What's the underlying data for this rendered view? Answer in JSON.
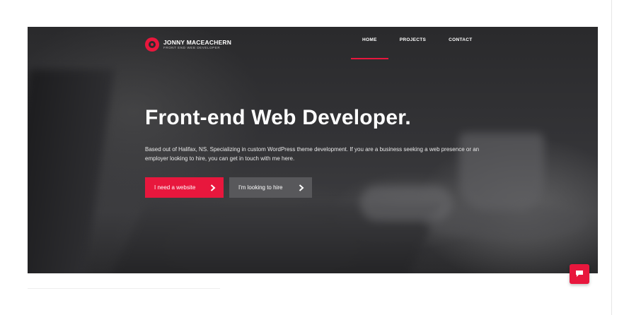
{
  "brand": {
    "name": "JONNY MACEACHERN",
    "tagline": "FRONT END WEB DEVELOPER"
  },
  "nav": {
    "items": [
      {
        "label": "HOME",
        "active": true
      },
      {
        "label": "PROJECTS",
        "active": false
      },
      {
        "label": "CONTACT",
        "active": false
      }
    ]
  },
  "hero": {
    "headline": "Front-end Web Developer.",
    "lead": "Based out of Halifax, NS. Specializing in custom WordPress theme development. If you are a business seeking a web presence or an employer looking to hire, you can get in touch with me here.",
    "primary_button": "I need a website",
    "secondary_button": "I'm looking to hire"
  },
  "icons": {
    "chevron": "chevron-right-icon",
    "chat": "chat-icon",
    "logo": "logo-icon"
  },
  "colors": {
    "accent": "#e8173d",
    "secondary_button": "#58585b",
    "hero_bg": "#333336"
  }
}
